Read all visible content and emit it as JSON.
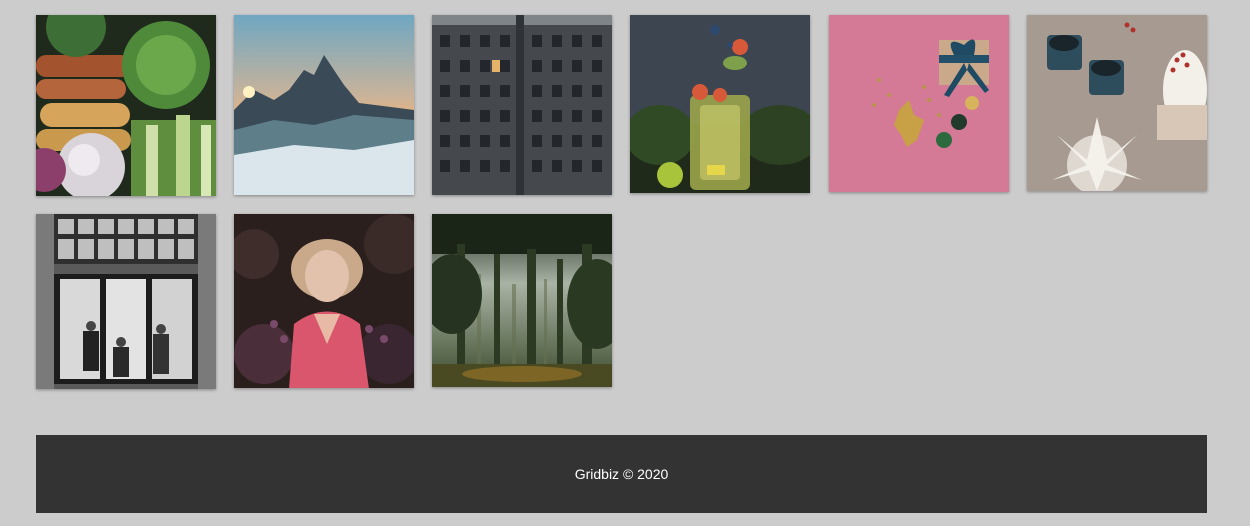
{
  "footer": {
    "copyright": "Gridbiz © 2020"
  },
  "colors": {
    "page_background": "#cccccc",
    "footer_background": "#333333",
    "footer_text": "#ffffff"
  },
  "gallery": {
    "images": [
      {
        "subject": "vegetables-photo"
      },
      {
        "subject": "mountain-sunrise-photo"
      },
      {
        "subject": "building-facade-photo"
      },
      {
        "subject": "herbal-tea-jar-photo"
      },
      {
        "subject": "pink-gift-flatlay-photo"
      },
      {
        "subject": "paper-star-candles-photo"
      },
      {
        "subject": "storefront-people-photo"
      },
      {
        "subject": "woman-in-flowers-photo"
      },
      {
        "subject": "misty-forest-photo"
      }
    ]
  }
}
